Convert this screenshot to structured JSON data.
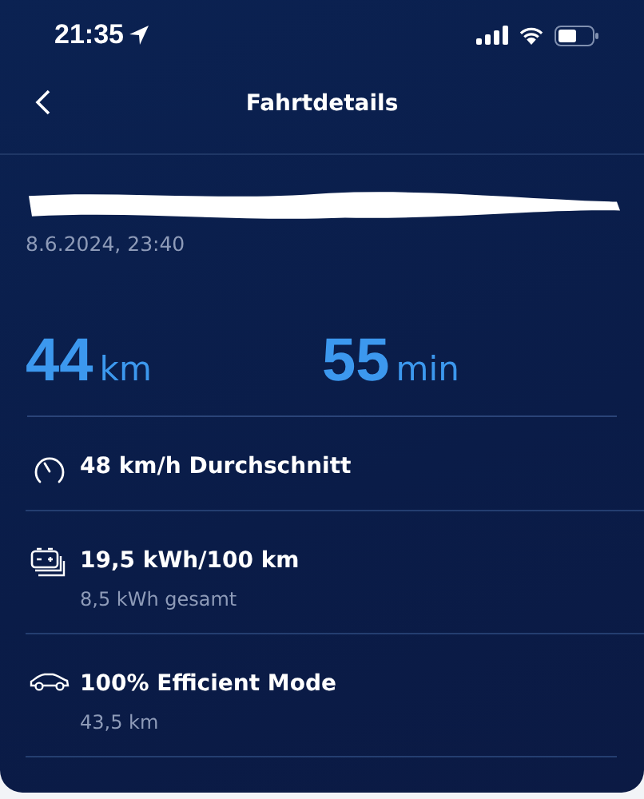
{
  "status_bar": {
    "time": "21:35"
  },
  "header": {
    "title": "Fahrtdetails"
  },
  "trip": {
    "date": "8.6.2024, 23:40"
  },
  "stats": [
    {
      "value": "44",
      "unit": "km"
    },
    {
      "value": "55",
      "unit": "min"
    }
  ],
  "details": [
    {
      "kind": "speed",
      "title": "48 km/h Durchschnitt"
    },
    {
      "kind": "energy",
      "title": "19,5 kWh/100 km",
      "subtitle": "8,5 kWh gesamt"
    },
    {
      "kind": "car",
      "title": "100% Efficient Mode",
      "subtitle": "43,5 km"
    }
  ]
}
